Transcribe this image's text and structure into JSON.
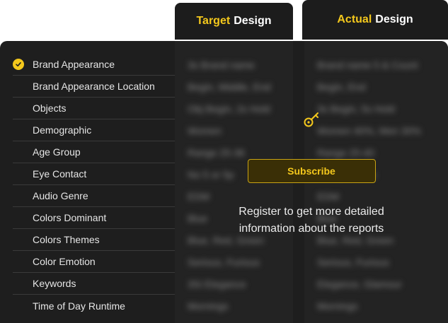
{
  "headers": {
    "target": {
      "accent": "Target",
      "rest": "Design"
    },
    "actual": {
      "accent": "Actual",
      "rest": "Design"
    }
  },
  "attributes": [
    {
      "label": "Brand Appearance",
      "checked": true
    },
    {
      "label": "Brand Appearance Location",
      "checked": false
    },
    {
      "label": "Objects",
      "checked": false
    },
    {
      "label": "Demographic",
      "checked": false
    },
    {
      "label": "Age Group",
      "checked": false
    },
    {
      "label": "Eye Contact",
      "checked": false
    },
    {
      "label": "Audio Genre",
      "checked": false
    },
    {
      "label": "Colors Dominant",
      "checked": false
    },
    {
      "label": "Colors Themes",
      "checked": false
    },
    {
      "label": "Color Emotion",
      "checked": false
    },
    {
      "label": "Keywords",
      "checked": false
    },
    {
      "label": "Time of Day Runtime",
      "checked": false
    }
  ],
  "target_values": [
    "3s Brand name",
    "Begin, Middle, End",
    "Obj Begin, 2s Hold",
    "Women",
    "Range 25-36",
    "No 5 or 5p",
    "EDM",
    "Blue",
    "Blue, Red, Green",
    "Serious, Furious",
    "3Si Elegance",
    "Mornings"
  ],
  "actual_values": [
    "Brand name 5 & Count",
    "Begin, End",
    "3s Begin, 5s Hold",
    "Women 40%, Men 30%",
    "Range 25-40",
    "Yes 10s Time",
    "EDM",
    "Blue",
    "Blue, Red, Green",
    "Serious, Furious",
    "Elegance, Glamour",
    "Mornings"
  ],
  "overlay": {
    "icon": "key-icon",
    "button_label": "Subscribe",
    "message": "Register to get more detailed information about the reports"
  },
  "colors": {
    "accent": "#f4c81c",
    "panel": "#1e1e1e"
  }
}
